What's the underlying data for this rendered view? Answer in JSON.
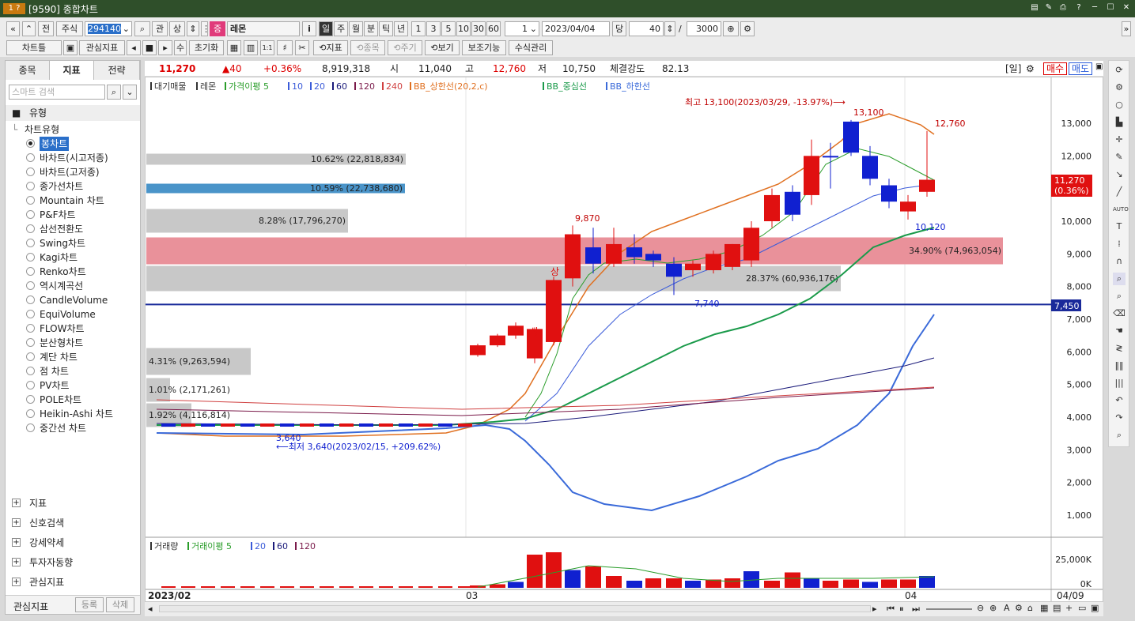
{
  "window": {
    "badge": "1 ?",
    "title": "[9590] 종합차트"
  },
  "toolbar": {
    "prev": "«",
    "up": "»",
    "jeon": "전",
    "stock_type": "주식",
    "code": "294140",
    "gwan": "관",
    "sang": "상",
    "jeung": "증",
    "name": "레몬",
    "info": "i",
    "periods": [
      "일",
      "주",
      "월",
      "분",
      "틱",
      "년"
    ],
    "periods_active": "일",
    "intervals": [
      "1",
      "3",
      "5",
      "10",
      "30",
      "60"
    ],
    "interval_value": "1",
    "date": "2023/04/04",
    "dang_label": "당",
    "count": "40",
    "total": "3000",
    "slash": "/"
  },
  "toolbar2": {
    "chart_style": "차트틀",
    "watch": "관심지표",
    "su": "수",
    "reset": "초기화",
    "one_one": "1:1",
    "indicator": "지표",
    "jongmok": "종목",
    "jugi": "주기",
    "view": "보기",
    "aux": "보조기능",
    "formula": "수식관리"
  },
  "left": {
    "tabs": [
      "종목",
      "지표",
      "전략"
    ],
    "active_tab": "지표",
    "search_placeholder": "스마트 검색",
    "category": "유형",
    "group": "차트유형",
    "chart_types": [
      "봉차트",
      "바차트(시고저종)",
      "바차트(고저종)",
      "종가선차트",
      "Mountain 차트",
      "P&F차트",
      "삼선전환도",
      "Swing차트",
      "Kagi차트",
      "Renko차트",
      "역시계곡선",
      "CandleVolume",
      "EquiVolume",
      "FLOW차트",
      "분산형차트",
      "계단 차트",
      "점 차트",
      "PV차트",
      "POLE차트",
      "Heikin-Ashi 차트",
      "중간선 차트"
    ],
    "selected": "봉차트",
    "sections": [
      "지표",
      "신호검색",
      "강세약세",
      "투자자동향",
      "관심지표"
    ],
    "footer": {
      "label": "관심지표",
      "register": "등록",
      "delete": "삭제"
    }
  },
  "quote": {
    "price": "11,270",
    "change": "▲40",
    "pct": "+0.36%",
    "volume": "8,919,318",
    "open_label": "시",
    "open": "11,040",
    "high_label": "고",
    "high": "12,760",
    "low_label": "저",
    "low": "10,750",
    "strength_label": "체결강도",
    "strength": "82.13",
    "period_tag": "[일]",
    "buy": "매수",
    "sell": "매도"
  },
  "legend": {
    "items": [
      "대기매물",
      "레몬",
      "가격이평 5",
      "10",
      "20",
      "60",
      "120",
      "240",
      "BB_상한선(20,2,c)",
      "BB_중심선",
      "BB_하한선"
    ],
    "colors": [
      "#333",
      "#333",
      "#2a9d2a",
      "#3a5bd9",
      "#3a5bd9",
      "#1a1a7a",
      "#7a1a4a",
      "#d04040",
      "#e07020",
      "#1a9a4a",
      "#3a6ad9"
    ]
  },
  "annotations": {
    "high_note": "최고 13,100(2023/03/29, -13.97%)⟶",
    "low_note": "⟵최저 3,640(2023/02/15, +209.62%)",
    "hi_val": "13,100",
    "last_high": "12,760",
    "val_9870": "9,870",
    "val_7740": "7,740",
    "val_10120": "10,120",
    "val_3640": "3,640",
    "sang": "상",
    "price_tag": "11,270",
    "price_tag_pct": "(0.36%)",
    "line_tag": "7,450"
  },
  "volume_profile": [
    {
      "label": "10.62% (22,818,834)",
      "pct": 10.62
    },
    {
      "label": "10.59% (22,738,680)",
      "pct": 10.59
    },
    {
      "label": "8.28% (17,796,270)",
      "pct": 8.28
    },
    {
      "label": "34.90% (74,963,054)",
      "pct": 34.9
    },
    {
      "label": "28.37% (60,936,176)",
      "pct": 28.37
    },
    {
      "label": "4.31% (9,263,594)",
      "pct": 4.31
    },
    {
      "label": "1.01% (2,171,261)",
      "pct": 1.01
    },
    {
      "label": "1.92% (4,116,814)",
      "pct": 1.92
    }
  ],
  "y_axis": [
    "13,000",
    "12,000",
    "11,000",
    "10,000",
    "9,000",
    "8,000",
    "7,000",
    "6,000",
    "5,000",
    "4,000",
    "3,000",
    "2,000",
    "1,000"
  ],
  "vol_legend": {
    "items": [
      "거래량",
      "거래이평 5",
      "20",
      "60",
      "120"
    ],
    "colors": [
      "#333",
      "#2a9d2a",
      "#3a5bd9",
      "#1a1a7a",
      "#7a1a4a"
    ]
  },
  "vol_axis": [
    "25,000K",
    "0K"
  ],
  "x_axis": {
    "start": "2023/02",
    "mid": "03",
    "end": "04",
    "last": "04/09"
  },
  "chart_data": {
    "type": "candlestick",
    "period": "daily",
    "candles": [
      {
        "o": 10300,
        "h": 10800,
        "l": 10050,
        "c": 10600,
        "color": "red"
      },
      {
        "o": 10600,
        "h": 11200,
        "l": 10200,
        "c": 11270,
        "color": "red"
      },
      {
        "o": 10900,
        "h": 12760,
        "l": 10750,
        "c": 11270,
        "color": "red"
      }
    ],
    "ylim": [
      700,
      13800
    ]
  }
}
